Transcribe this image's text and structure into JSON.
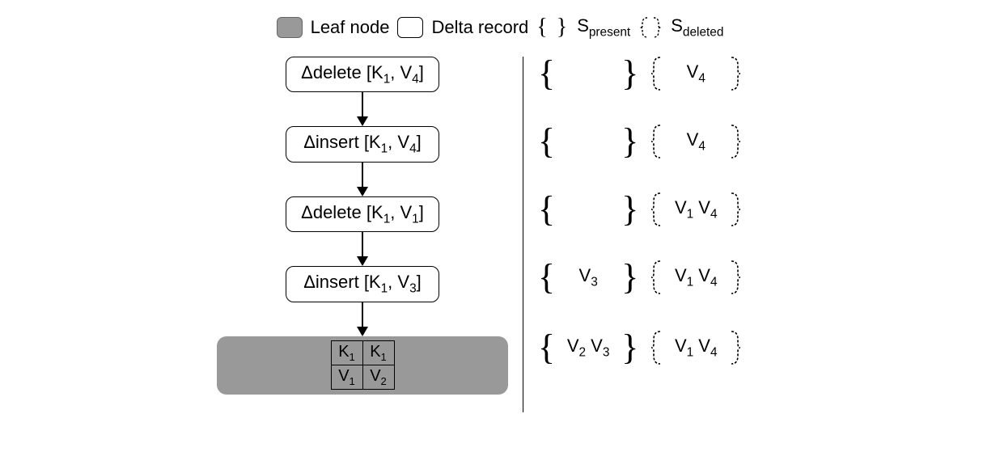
{
  "legend": {
    "leaf_label": "Leaf node",
    "delta_label": "Delta record",
    "spresent_label": "S",
    "spresent_sub": "present",
    "sdeleted_label": "S",
    "sdeleted_sub": "deleted"
  },
  "deltas": [
    {
      "op": "Δdelete",
      "key": "K",
      "ksub": "1",
      "val": "V",
      "vsub": "4"
    },
    {
      "op": "Δinsert",
      "key": "K",
      "ksub": "1",
      "val": "V",
      "vsub": "4"
    },
    {
      "op": "Δdelete",
      "key": "K",
      "ksub": "1",
      "val": "V",
      "vsub": "1"
    },
    {
      "op": "Δinsert",
      "key": "K",
      "ksub": "1",
      "val": "V",
      "vsub": "3"
    }
  ],
  "leaf": {
    "cells": [
      {
        "k": "K",
        "ksub": "1",
        "v": "V",
        "vsub": "1"
      },
      {
        "k": "K",
        "ksub": "1",
        "v": "V",
        "vsub": "2"
      }
    ]
  },
  "rows": [
    {
      "present": [],
      "deleted": [
        {
          "v": "V",
          "s": "4"
        }
      ]
    },
    {
      "present": [],
      "deleted": [
        {
          "v": "V",
          "s": "4"
        }
      ]
    },
    {
      "present": [],
      "deleted": [
        {
          "v": "V",
          "s": "1"
        },
        {
          "v": "V",
          "s": "4"
        }
      ]
    },
    {
      "present": [
        {
          "v": "V",
          "s": "3"
        }
      ],
      "deleted": [
        {
          "v": "V",
          "s": "1"
        },
        {
          "v": "V",
          "s": "4"
        }
      ]
    },
    {
      "present": [
        {
          "v": "V",
          "s": "2"
        },
        {
          "v": "V",
          "s": "3"
        }
      ],
      "deleted": [
        {
          "v": "V",
          "s": "1"
        },
        {
          "v": "V",
          "s": "4"
        }
      ]
    }
  ]
}
